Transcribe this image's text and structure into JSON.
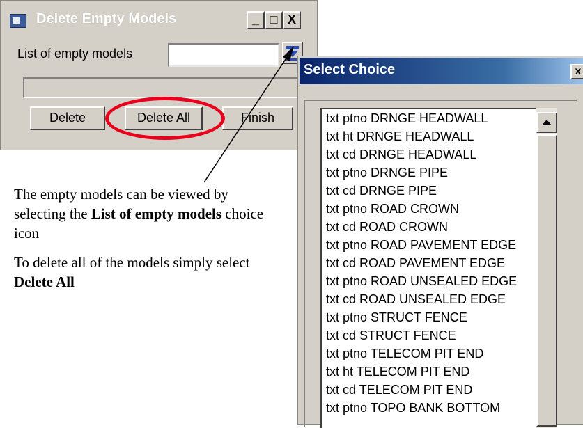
{
  "delete_dialog": {
    "title": "Delete Empty Models",
    "list_label": "List of empty models",
    "list_value": "",
    "buttons": {
      "delete": "Delete",
      "delete_all": "Delete All",
      "finish": "Finish"
    },
    "caption_buttons": [
      "_",
      "□",
      "X"
    ]
  },
  "choice_dialog": {
    "title": "Select Choice",
    "close": "x",
    "items": [
      "txt ptno DRNGE HEADWALL",
      "txt ht DRNGE HEADWALL",
      "txt cd DRNGE HEADWALL",
      "txt ptno DRNGE PIPE",
      "txt cd DRNGE PIPE",
      "txt ptno ROAD CROWN",
      "txt cd ROAD CROWN",
      "txt ptno ROAD PAVEMENT EDGE",
      "txt cd ROAD PAVEMENT EDGE",
      "txt ptno ROAD UNSEALED EDGE",
      "txt cd ROAD UNSEALED EDGE",
      "txt ptno STRUCT FENCE",
      "txt cd STRUCT FENCE",
      "txt ptno TELECOM PIT END",
      "txt ht TELECOM PIT END",
      "txt cd TELECOM PIT END",
      "txt ptno TOPO BANK BOTTOM"
    ]
  },
  "annotation": {
    "p1_a": "The empty models can be viewed by selecting the ",
    "p1_bold": "List of empty models",
    "p1_b": " choice icon",
    "p2_a": "To delete all of the models simply select ",
    "p2_bold": "Delete All"
  },
  "colors": {
    "highlight": "#e8001c",
    "titlebar_active": "#0a246a"
  },
  "icons": {
    "app": "app-window-icon",
    "choice": "choice-list-icon",
    "scroll_up": "triangle-up-icon"
  }
}
